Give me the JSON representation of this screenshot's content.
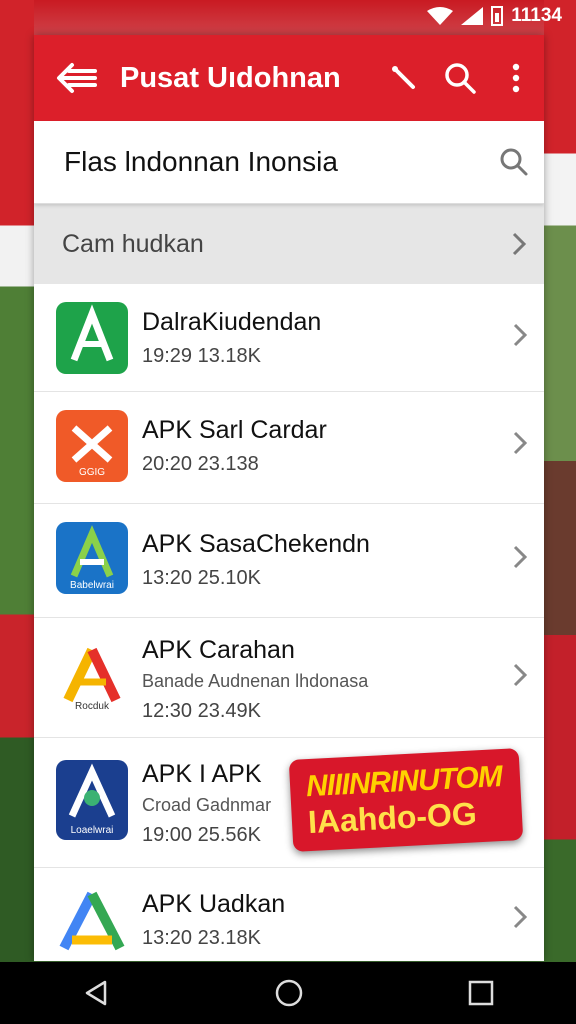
{
  "status": {
    "time": "11134"
  },
  "appbar": {
    "title": "Pusat Uıdohnan"
  },
  "search": {
    "text": "Flas lndonnan Inonsia"
  },
  "category": {
    "label": "Cam hudkan"
  },
  "items": [
    {
      "name": "DalraKiudendan",
      "meta": "19:29  13.18K",
      "icon_color": "#1ea34a",
      "icon": "green-a-icon",
      "icon_caption": ""
    },
    {
      "name": "APK Sarl Cardar",
      "meta": "20:20  23.138",
      "icon_color": "#f05a28",
      "icon": "orange-x-icon",
      "icon_caption": "GGIG"
    },
    {
      "name": "APK SasaChekendn",
      "meta": "13:20  25.10K",
      "icon_color": "#1a73c7",
      "icon": "blue-a-icon",
      "icon_caption": "Babelwrai"
    },
    {
      "name": "APK Carahan",
      "sub": "Banade Audnenan lhdonasa",
      "meta": "12:30  23.49K",
      "icon_color": "#ffffff",
      "icon": "red-yellow-a-icon",
      "icon_caption": "Rocduk"
    },
    {
      "name": "APK I APK",
      "sub": "Croad Gadnmar",
      "meta": "19:00  25.56K",
      "icon_color": "#1b3f8f",
      "icon": "navy-a-icon",
      "icon_caption": "Loaelwrai"
    },
    {
      "name": "APK Uadkan",
      "meta": "13:20  23.18K",
      "icon_color": "#ffffff",
      "icon": "google-a-icon",
      "icon_caption": ""
    }
  ],
  "badge": {
    "line1": "NIIINRINUTOM",
    "line2": "IAahdo-OG"
  },
  "colors": {
    "accent": "#dc1f2a",
    "badge": "#d8172a",
    "badge_text": "#ffd200"
  }
}
